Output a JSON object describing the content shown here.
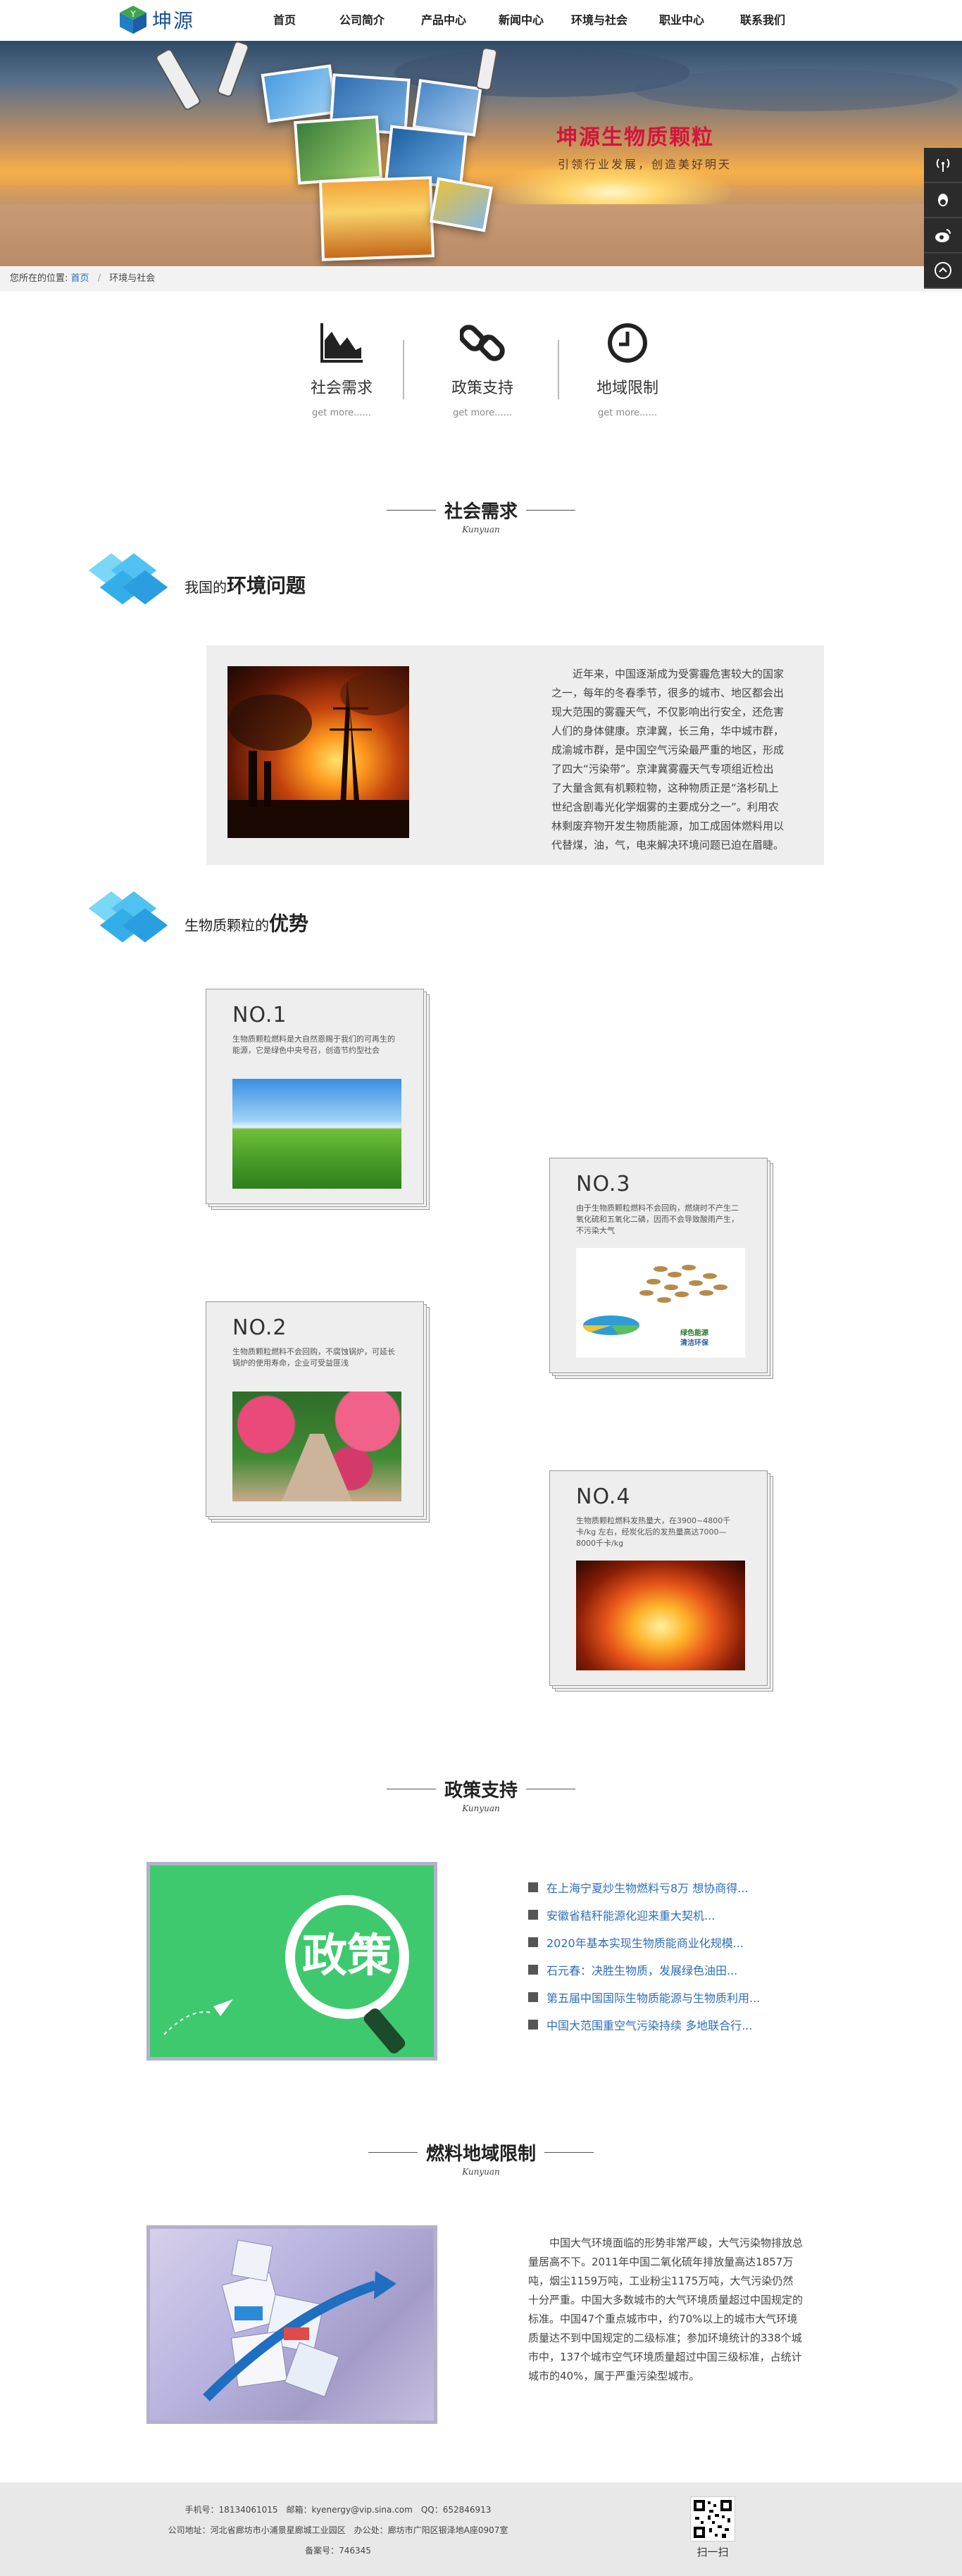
{
  "header": {
    "logo_text": "坤源",
    "nav": [
      {
        "label": "首页"
      },
      {
        "label": "公司简介"
      },
      {
        "label": "产品中心"
      },
      {
        "label": "新闻中心"
      },
      {
        "label": "环境与社会"
      },
      {
        "label": "职业中心"
      },
      {
        "label": "联系我们"
      }
    ]
  },
  "banner": {
    "title": "坤源生物质颗粒",
    "subtitle": "引领行业发展，创造美好明天"
  },
  "breadcrumb": {
    "prefix": "您所在的位置:",
    "home": "首页",
    "separator": "/",
    "current": "环境与社会"
  },
  "subnav": [
    {
      "label": "社会需求",
      "more": "get more......",
      "icon": "area-chart-icon"
    },
    {
      "label": "政策支持",
      "more": "get more......",
      "icon": "chain-link-icon"
    },
    {
      "label": "地域限制",
      "more": "get more......",
      "icon": "clock-icon"
    }
  ],
  "social": {
    "title": "社会需求",
    "script": "Kunyuan",
    "env_heading_prefix": "我国的",
    "env_heading_bold": "环境问题",
    "env_text": "近年来，中国逐渐成为受雾霾危害较大的国家之一，每年的冬春季节，很多的城市、地区都会出现大范围的雾霾天气，不仅影响出行安全，还危害人们的身体健康。京津冀，长三角，华中城市群，成渝城市群，是中国空气污染最严重的地区，形成了四大“污染带”。京津冀雾霾天气专项组近检出了大量含氮有机颗粒物，这种物质正是“洛杉矶上世纪含剧毒光化学烟雾的主要成分之一”。利用农林剩废弃物开发生物质能源，加工成固体燃料用以代替煤，油，气，电来解决环境问题已迫在眉睫。",
    "adv_heading_prefix": "生物质颗粒的",
    "adv_heading_bold": "优势"
  },
  "advantages": [
    {
      "no": "NO.1",
      "desc": "生物质颗粒燃料是大自然恩赐于我们的可再生的能源，它是绿色中央号召，创造节约型社会"
    },
    {
      "no": "NO.2",
      "desc": "生物质颗粒燃料不会回购，不腐蚀锅炉，可延长锅炉的使用寿命，企业可受益匪浅"
    },
    {
      "no": "NO.3",
      "desc": "由于生物质颗粒燃料不会回购，燃烧时不产生二氧化硫和五氧化二磷，因而不会导致酸雨产生，不污染大气",
      "pie_label_1": "绿色能源",
      "pie_label_2": "清洁环保"
    },
    {
      "no": "NO.4",
      "desc": "生物质颗粒燃料发热量大，在3900~4800千卡/kg 左右，经炭化后的发热量高达7000—8000千卡/kg"
    }
  ],
  "policy": {
    "title": "政策支持",
    "script": "Kunyuan",
    "image_text": "政策",
    "items": [
      "在上海宁夏炒生物燃料亏8万 想协商得...",
      "安徽省秸秆能源化迎来重大契机...",
      "2020年基本实现生物质能商业化规模...",
      "石元春：决胜生物质，发展绿色油田...",
      "第五届中国国际生物质能源与生物质利用...",
      "中国大范围重空气污染持续 多地联合行..."
    ]
  },
  "region": {
    "title": "燃料地域限制",
    "script": "Kunyuan",
    "text": "中国大气环境面临的形势非常严峻，大气污染物排放总量居高不下。2011年中国二氧化硫年排放量高达1857万吨，烟尘1159万吨，工业粉尘1175万吨，大气污染仍然十分严重。中国大多数城市的大气环境质量超过中国规定的标准。中国47个重点城市中，约70%以上的城市大气环境质量达不到中国规定的二级标准；参加环境统计的338个城市中，137个城市空气环境质量超过中国三级标准，占统计城市的40%，属于严重污染型城市。"
  },
  "footer": {
    "contact": "手机号：18134061015　邮箱：kyenergy@vip.sina.com　QQ：652846913",
    "address": "公司地址：河北省廊坊市小浦景星廊城工业园区　办公处：廊坊市广阳区银泽地A座0907室",
    "icp": "备案号：746345",
    "qr_label": "扫一扫"
  },
  "colors": {
    "banner_title": "#d4143a",
    "link": "#2e6eb8",
    "cube": "#39b7f0",
    "policy_bg": "#3ec96e"
  }
}
